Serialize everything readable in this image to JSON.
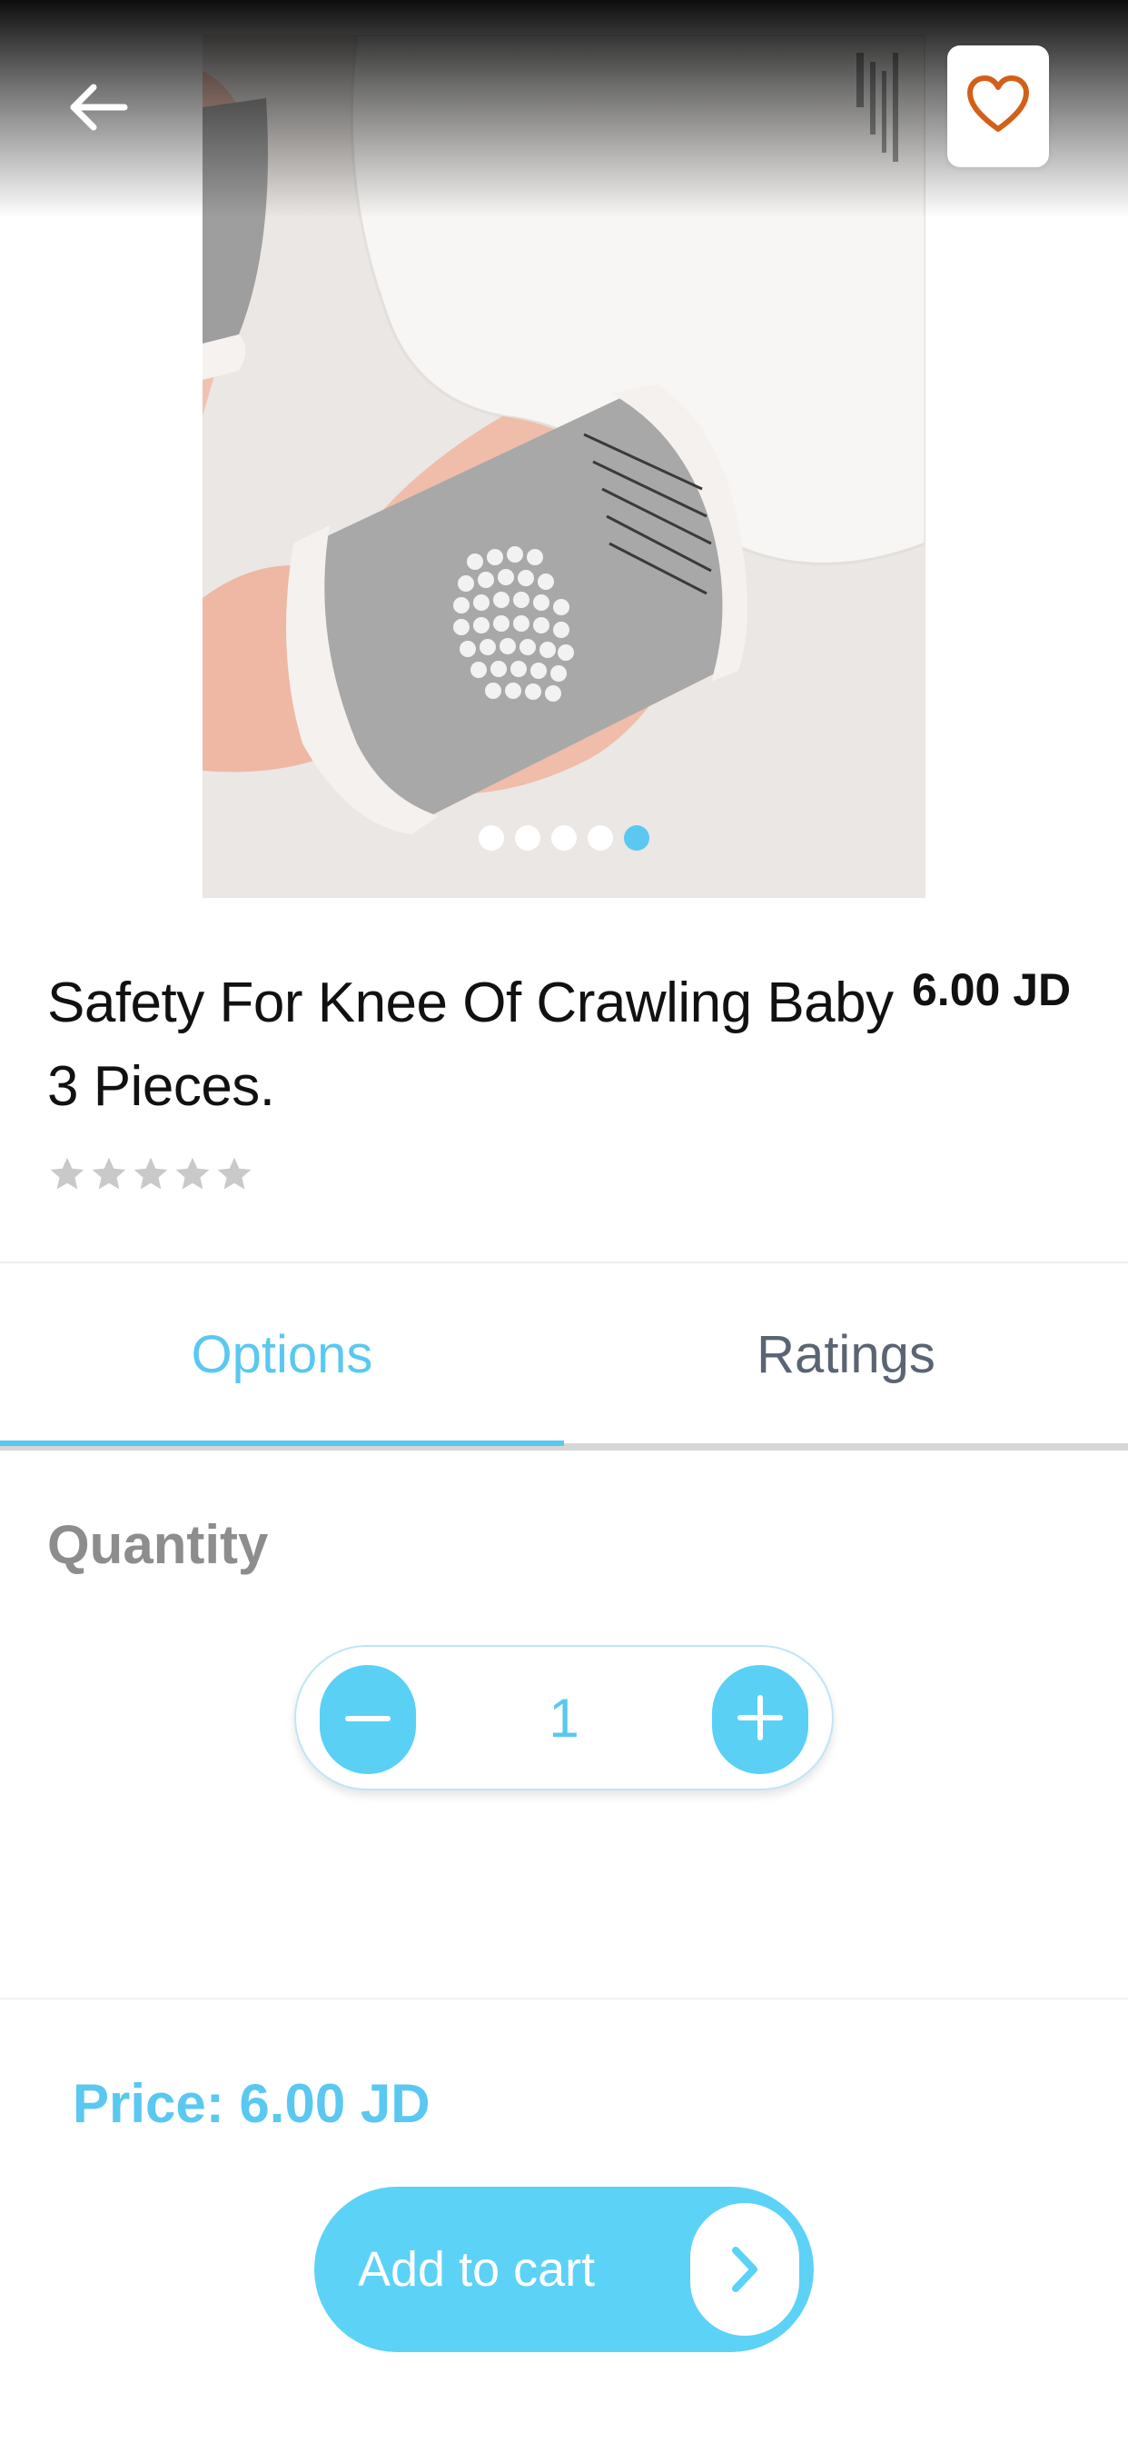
{
  "header": {
    "back_icon": "arrow-left-icon",
    "favorite_icon": "heart-outline-icon",
    "favorite_color": "#d2601a"
  },
  "gallery": {
    "image_count": 5,
    "active_index": 4,
    "dot_color": "#ffffff",
    "active_dot_color": "#5ac8f0"
  },
  "product": {
    "title_line1": "Safety For Knee Of Crawling Baby",
    "title_line2": "3 Pieces.",
    "price": "6.00 JD",
    "rating": 0,
    "rating_max": 5
  },
  "tabs": [
    {
      "label": "Options",
      "active": true
    },
    {
      "label": "Ratings",
      "active": false
    }
  ],
  "options": {
    "quantity_label": "Quantity",
    "quantity_value": "1",
    "minus_icon": "minus-icon",
    "plus_icon": "plus-icon"
  },
  "footer": {
    "total_price": "Price: 6.00 JD",
    "add_to_cart_label": "Add to cart",
    "cart_arrow_icon": "chevron-right-icon"
  },
  "colors": {
    "accent": "#5ac8f0",
    "button": "#5cd2f7",
    "star_empty": "#c9c9c9",
    "text": "#111111",
    "muted": "#8d8d8d"
  }
}
